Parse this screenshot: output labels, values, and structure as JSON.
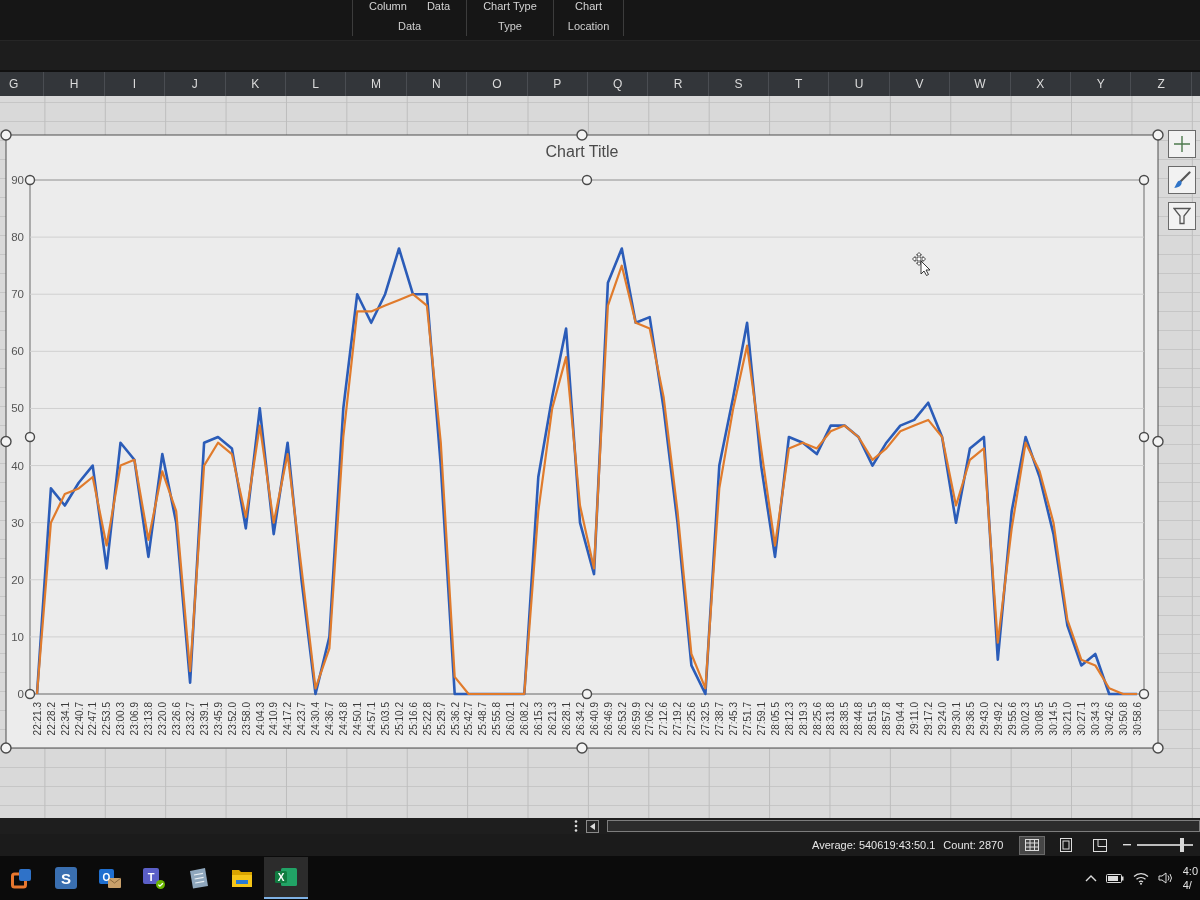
{
  "ribbon": {
    "groups": [
      {
        "label": "Data",
        "buttons": [
          "Column",
          "Data"
        ]
      },
      {
        "label": "Type",
        "buttons": [
          "Chart Type"
        ]
      },
      {
        "label": "Location",
        "buttons": [
          "Chart"
        ]
      }
    ]
  },
  "columns": [
    "G",
    "H",
    "I",
    "J",
    "K",
    "L",
    "M",
    "N",
    "O",
    "P",
    "Q",
    "R",
    "S",
    "T",
    "U",
    "V",
    "W",
    "X",
    "Y",
    "Z"
  ],
  "chart": {
    "selected": true,
    "plot_area_selected": true,
    "chart_data": {
      "type": "line",
      "title": "Chart Title",
      "categories": [
        "22:21.3",
        "22:28.2",
        "22:34.1",
        "22:40.7",
        "22:47.1",
        "22:53.5",
        "23:00.3",
        "23:06.9",
        "23:13.8",
        "23:20.0",
        "23:26.6",
        "23:32.7",
        "23:39.1",
        "23:45.9",
        "23:52.0",
        "23:58.0",
        "24:04.3",
        "24:10.9",
        "24:17.2",
        "24:23.7",
        "24:30.4",
        "24:36.7",
        "24:43.8",
        "24:50.1",
        "24:57.1",
        "25:03.5",
        "25:10.2",
        "25:16.6",
        "25:22.8",
        "25:29.7",
        "25:36.2",
        "25:42.7",
        "25:48.7",
        "25:55.8",
        "26:02.1",
        "26:08.2",
        "26:15.3",
        "26:21.3",
        "26:28.1",
        "26:34.2",
        "26:40.9",
        "26:46.9",
        "26:53.2",
        "26:59.9",
        "27:06.2",
        "27:12.6",
        "27:19.2",
        "27:25.6",
        "27:32.5",
        "27:38.7",
        "27:45.3",
        "27:51.7",
        "27:59.1",
        "28:05.5",
        "28:12.3",
        "28:19.3",
        "28:25.6",
        "28:31.8",
        "28:38.5",
        "28:44.8",
        "28:51.5",
        "28:57.8",
        "29:04.4",
        "29:11.0",
        "29:17.2",
        "29:24.0",
        "29:30.1",
        "29:36.5",
        "29:43.0",
        "29:49.2",
        "29:55.6",
        "30:02.3",
        "30:08.5",
        "30:14.5",
        "30:21.0",
        "30:27.1",
        "30:34.3",
        "30:42.6",
        "30:50.8",
        "30:58.6"
      ],
      "series": [
        {
          "color": "#2b5cb8",
          "values": [
            0,
            36,
            33,
            37,
            40,
            22,
            44,
            41,
            24,
            42,
            30,
            2,
            44,
            45,
            43,
            29,
            50,
            28,
            44,
            20,
            0,
            10,
            50,
            70,
            65,
            70,
            78,
            70,
            70,
            40,
            0,
            0,
            0,
            0,
            0,
            0,
            38,
            52,
            64,
            30,
            21,
            72,
            78,
            65,
            66,
            50,
            30,
            5,
            0,
            40,
            52,
            65,
            40,
            24,
            45,
            44,
            42,
            47,
            47,
            45,
            40,
            44,
            47,
            48,
            51,
            45,
            30,
            43,
            45,
            6,
            32,
            45,
            38,
            28,
            12,
            5,
            7,
            0,
            0,
            0
          ]
        },
        {
          "color": "#e07b2c",
          "values": [
            0,
            30,
            35,
            36,
            38,
            26,
            40,
            41,
            27,
            39,
            32,
            4,
            40,
            44,
            42,
            31,
            47,
            30,
            42,
            22,
            1,
            8,
            45,
            67,
            67,
            68,
            69,
            70,
            68,
            44,
            3,
            0,
            0,
            0,
            0,
            0,
            32,
            50,
            59,
            33,
            22,
            68,
            75,
            65,
            64,
            52,
            32,
            7,
            1,
            36,
            50,
            61,
            43,
            26,
            43,
            44,
            43,
            46,
            47,
            45,
            41,
            43,
            46,
            47,
            48,
            45,
            33,
            41,
            43,
            9,
            29,
            44,
            39,
            30,
            13,
            6,
            5,
            1,
            0,
            0
          ]
        }
      ],
      "ylim": [
        0,
        90
      ],
      "yticks": [
        0,
        10,
        20,
        30,
        40,
        50,
        60,
        70,
        80,
        90
      ],
      "grid": true
    }
  },
  "status_bar": {
    "average": "Average: 540619:43:50.1",
    "count": "Count: 2870",
    "views": [
      {
        "kind": "normal",
        "selected": true
      },
      {
        "kind": "page_layout",
        "selected": false
      },
      {
        "kind": "page_break",
        "selected": false
      }
    ],
    "zoom": {
      "level": 0.8
    }
  },
  "taskbar": {
    "apps": [
      {
        "kind": "squares",
        "active": false
      },
      {
        "kind": "letter_tile",
        "letter": "S",
        "active": false
      },
      {
        "kind": "mail",
        "letter": "O",
        "active": false
      },
      {
        "kind": "people",
        "letter": "T",
        "active": false
      },
      {
        "kind": "notepad",
        "active": false
      },
      {
        "kind": "folder",
        "active": false
      },
      {
        "kind": "sheet",
        "letter": "X",
        "active": true
      }
    ],
    "clock": {
      "time": "4:0",
      "date": "4/"
    }
  }
}
